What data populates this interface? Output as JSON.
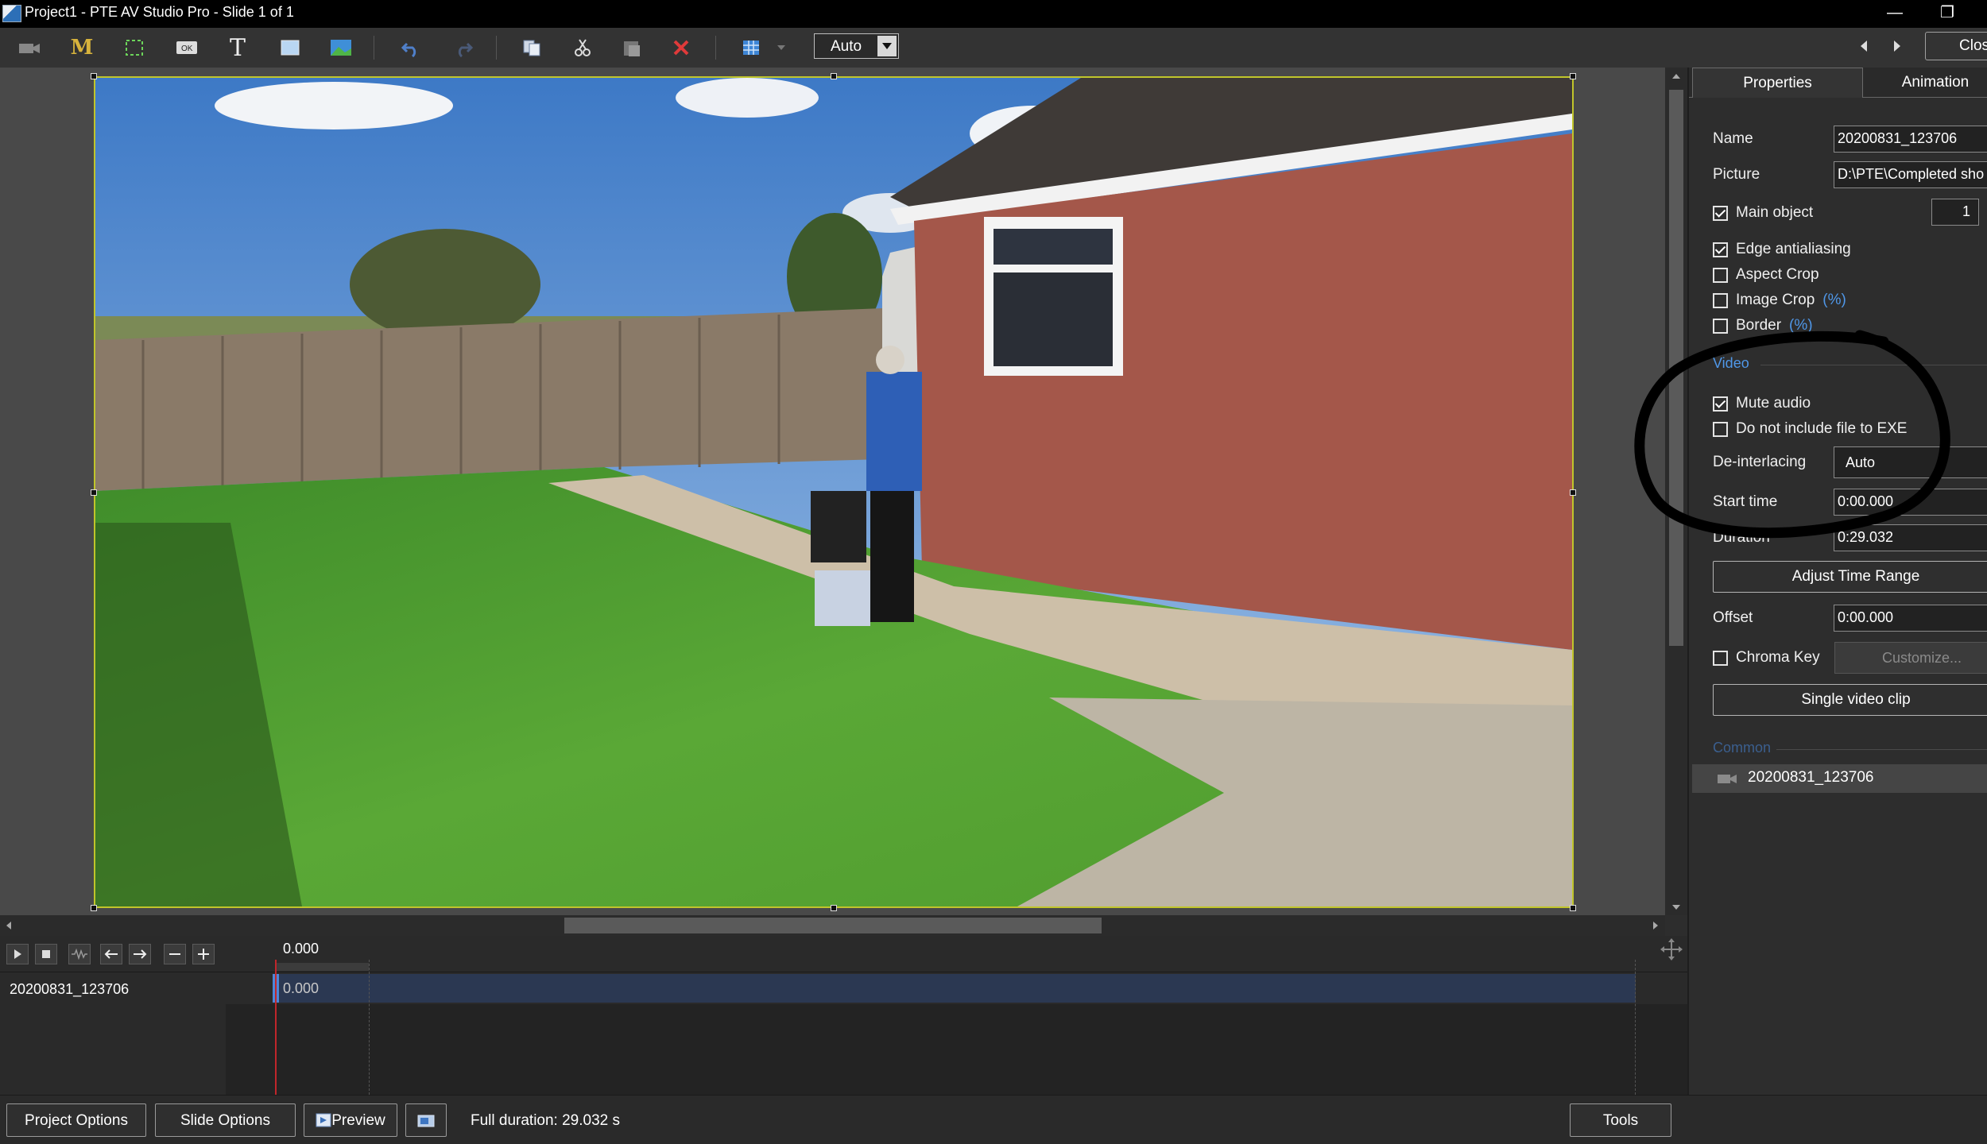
{
  "window": {
    "title": "Project1 - PTE AV Studio Pro - Slide 1 of 1",
    "close_label": "Clos"
  },
  "toolbar": {
    "zoom_value": "Auto",
    "icons": [
      "video-camera-icon",
      "mask-icon",
      "frame-icon",
      "button-icon",
      "text-icon",
      "rectangle-icon",
      "image-icon",
      "undo-icon",
      "redo-icon",
      "copy-icon",
      "cut-icon",
      "paste-icon",
      "delete-icon",
      "grid-icon"
    ]
  },
  "panel": {
    "tabs": [
      "Properties",
      "Animation"
    ],
    "name_label": "Name",
    "name_value": "20200831_123706",
    "picture_label": "Picture",
    "picture_value": "D:\\PTE\\Completed sho",
    "main_object_label": "Main object",
    "main_object_value": "1",
    "edge_antialiasing_label": "Edge antialiasing",
    "aspect_crop_label": "Aspect Crop",
    "image_crop_label": "Image Crop",
    "border_label": "Border",
    "percent_label": "(%)",
    "video_section": "Video",
    "mute_audio_label": "Mute audio",
    "no_include_label": "Do not include file to EXE",
    "deinterlacing_label": "De-interlacing",
    "deinterlacing_value": "Auto",
    "start_time_label": "Start time",
    "start_time_value": "0:00.000",
    "duration_label": "Duration",
    "duration_value": "0:29.032",
    "adjust_time_range_label": "Adjust Time Range",
    "offset_label": "Offset",
    "offset_value": "0:00.000",
    "chroma_key_label": "Chroma Key",
    "customize_label": "Customize...",
    "single_video_clip_label": "Single video clip",
    "common_section": "Common",
    "object_list": [
      "20200831_123706"
    ]
  },
  "timeline": {
    "ruler_time": "0.000",
    "track_name": "20200831_123706",
    "clip_time": "0.000"
  },
  "bottombar": {
    "project_options": "Project Options",
    "slide_options": "Slide Options",
    "preview": "Preview",
    "full_duration": "Full duration: 29.032 s",
    "tools": "Tools"
  },
  "colors": {
    "accent_blue": "#4f97e8",
    "selection_frame": "#c0c52b",
    "playhead": "#c0262b"
  }
}
